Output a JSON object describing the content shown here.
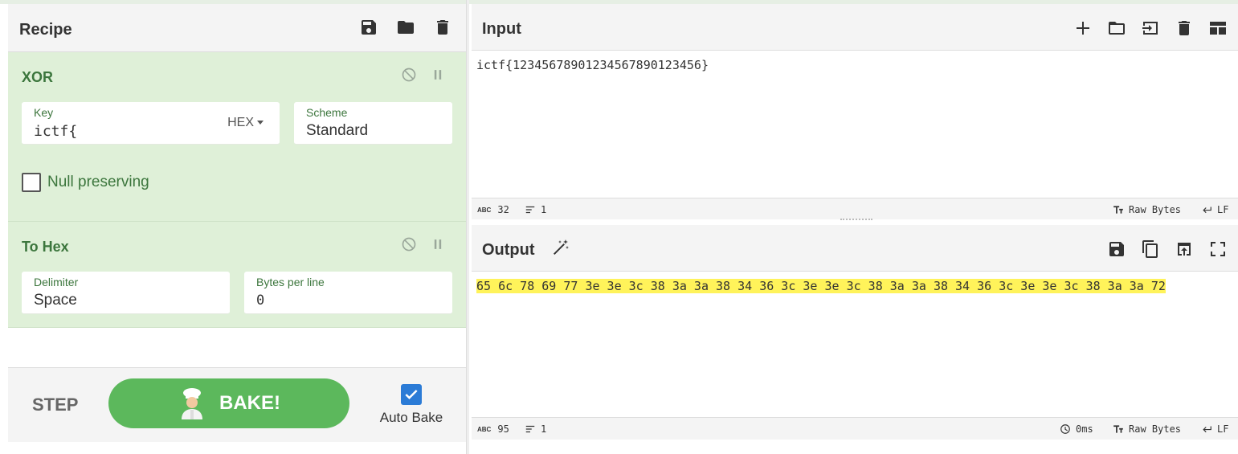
{
  "recipe": {
    "title": "Recipe",
    "operations": [
      {
        "name": "XOR",
        "key_label": "Key",
        "key_value": "ictf{",
        "key_format": "HEX",
        "scheme_label": "Scheme",
        "scheme_value": "Standard",
        "null_preserving_label": "Null preserving",
        "null_preserving": false
      },
      {
        "name": "To Hex",
        "delimiter_label": "Delimiter",
        "delimiter_value": "Space",
        "bytes_per_line_label": "Bytes per line",
        "bytes_per_line_value": "0"
      }
    ],
    "step_label": "STEP",
    "bake_label": "BAKE!",
    "auto_bake_label": "Auto Bake",
    "auto_bake": true
  },
  "input": {
    "title": "Input",
    "text": "ictf{12345678901234567890123456}",
    "length": "32",
    "lines": "1",
    "encoding": "Raw Bytes",
    "eol": "LF"
  },
  "output": {
    "title": "Output",
    "text": "65 6c 78 69 77 3e 3e 3c 38 3a 3a 38 34 36 3c 3e 3e 3c 38 3a 3a 38 34 36 3c 3e 3e 3c 38 3a 3a 72",
    "length": "95",
    "lines": "1",
    "time": "0ms",
    "encoding": "Raw Bytes",
    "eol": "LF"
  },
  "colors": {
    "accent_green": "#5cb85c",
    "op_background": "#dff0d8",
    "op_text": "#3c763d",
    "highlight": "#fff35a",
    "checkbox_blue": "#2b7bd6"
  }
}
